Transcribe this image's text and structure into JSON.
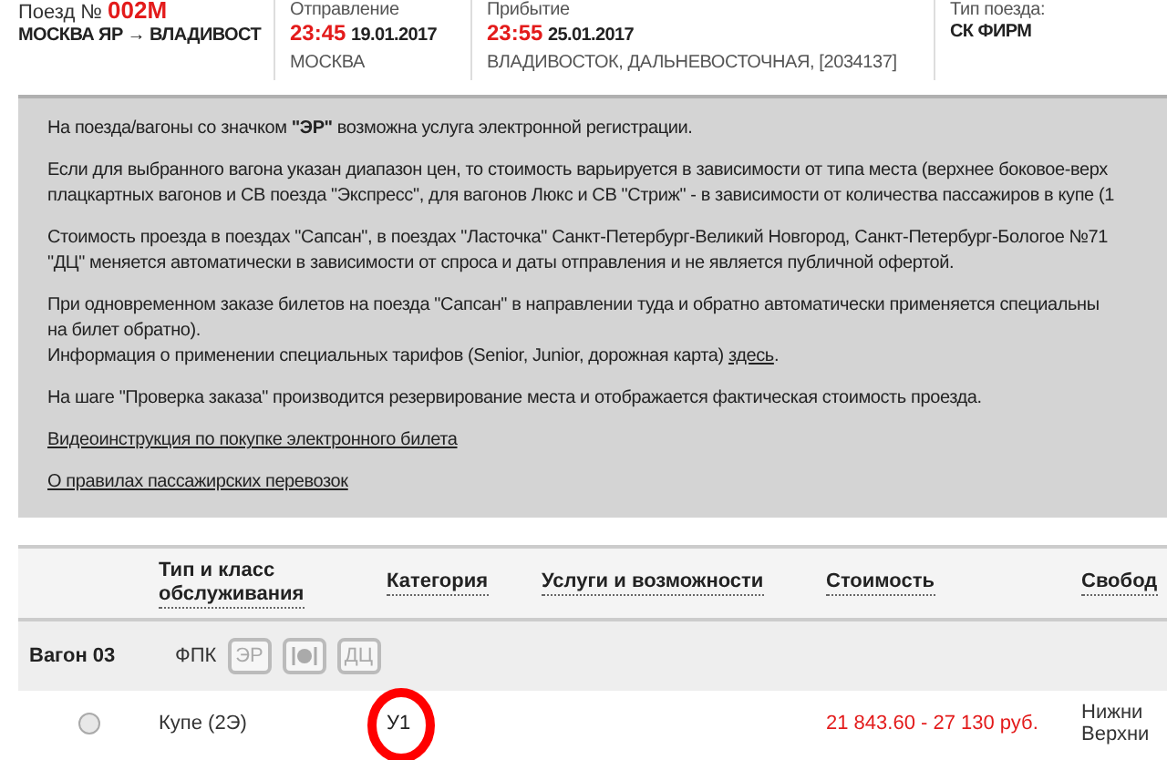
{
  "train": {
    "number_label": "Поезд №",
    "number": "002М",
    "route": "МОСКВА ЯР → ВЛАДИВОСТ"
  },
  "departure": {
    "label": "Отправление",
    "time": "23:45",
    "date": "19.01.2017",
    "station": "МОСКВА"
  },
  "arrival": {
    "label": "Прибытие",
    "time": "23:55",
    "date": "25.01.2017",
    "station": "ВЛАДИВОСТОК, ДАЛЬНЕВОСТОЧНАЯ, [2034137]"
  },
  "train_type": {
    "label": "Тип поезда:",
    "value": "СК ФИРМ"
  },
  "info": {
    "paragraphs": [
      {
        "lines": [
          {
            "text": "На поезда/вагоны со значком **\"ЭР\"** возможна услуга электронной регистрации."
          }
        ]
      },
      {
        "lines": [
          {
            "text": "Если для выбранного вагона указан диапазон цен, то стоимость варьируется в зависимости от типа места (верхнее боковое-верх"
          },
          {
            "text": "плацкартных вагонов и СВ поезда \"Экспресс\", для вагонов Люкс и СВ \"Стриж\" - в зависимости от количества пассажиров в купе (1"
          }
        ]
      },
      {
        "lines": [
          {
            "text": "Стоимость проезда в поездах \"Сапсан\", в поездах \"Ласточка\" Санкт-Петербург-Великий Новгород, Санкт-Петербург-Бологое №71"
          },
          {
            "text": "\"ДЦ\" меняется автоматически в зависимости от спроса и даты отправления и не является публичной офертой."
          }
        ]
      },
      {
        "lines": [
          {
            "text": "При одновременном заказе билетов на поезда \"Сапсан\" в направлении туда и обратно автоматически применяется специальны"
          },
          {
            "text": "на билет обратно)."
          },
          {
            "text": "Информация о применении специальных тарифов (Senior, Junior, дорожная карта)",
            "link": "здесь",
            "after": "."
          }
        ]
      },
      {
        "lines": [
          {
            "text": "На шаге \"Проверка заказа\" производится резервирование места и отображается фактическая стоимость проезда."
          }
        ]
      }
    ],
    "links": [
      "Видеоинструкция по покупке электронного билета",
      "О правилах пассажирских перевозок"
    ]
  },
  "table": {
    "columns": [
      {
        "label": "Тип и класс обслуживания"
      },
      {
        "label": "Категория"
      },
      {
        "label": "Услуги и возможности"
      },
      {
        "label": "Стоимость"
      },
      {
        "label": "Свобод"
      }
    ],
    "wagon": {
      "name": "Вагон 03",
      "carrier": "ФПК",
      "badges": [
        {
          "kind": "text",
          "label": "ЭР"
        },
        {
          "kind": "meal"
        },
        {
          "kind": "text",
          "label": "ДЦ"
        }
      ]
    },
    "rows": [
      {
        "selected": false,
        "type": "Купе (2Э)",
        "category": "У1",
        "circled": true,
        "price": "21 843.60 - 27 130 руб.",
        "seats": [
          "Нижни",
          "Верхни"
        ]
      }
    ]
  }
}
